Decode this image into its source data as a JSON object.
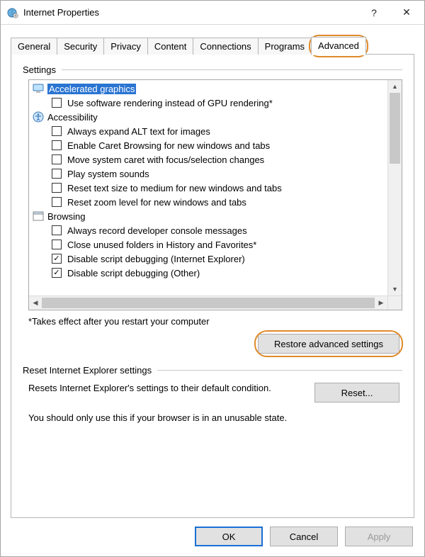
{
  "window": {
    "title": "Internet Properties",
    "help_label": "?",
    "close_label": "✕"
  },
  "tabs": [
    "General",
    "Security",
    "Privacy",
    "Content",
    "Connections",
    "Programs",
    "Advanced"
  ],
  "active_tab_index": 6,
  "settings_group_label": "Settings",
  "tree": {
    "categories": [
      {
        "icon": "monitor-icon",
        "label": "Accelerated graphics",
        "selected": true,
        "options": [
          {
            "label": "Use software rendering instead of GPU rendering*",
            "checked": false
          }
        ]
      },
      {
        "icon": "accessibility-icon",
        "label": "Accessibility",
        "selected": false,
        "options": [
          {
            "label": "Always expand ALT text for images",
            "checked": false
          },
          {
            "label": "Enable Caret Browsing for new windows and tabs",
            "checked": false
          },
          {
            "label": "Move system caret with focus/selection changes",
            "checked": false
          },
          {
            "label": "Play system sounds",
            "checked": false
          },
          {
            "label": "Reset text size to medium for new windows and tabs",
            "checked": false
          },
          {
            "label": "Reset zoom level for new windows and tabs",
            "checked": false
          }
        ]
      },
      {
        "icon": "window-icon",
        "label": "Browsing",
        "selected": false,
        "options": [
          {
            "label": "Always record developer console messages",
            "checked": false
          },
          {
            "label": "Close unused folders in History and Favorites*",
            "checked": false
          },
          {
            "label": "Disable script debugging (Internet Explorer)",
            "checked": true
          },
          {
            "label": "Disable script debugging (Other)",
            "checked": true
          }
        ]
      }
    ]
  },
  "restart_note": "*Takes effect after you restart your computer",
  "restore_button": "Restore advanced settings",
  "reset_group_label": "Reset Internet Explorer settings",
  "reset_text": "Resets Internet Explorer's settings to their default condition.",
  "reset_button": "Reset...",
  "reset_warning": "You should only use this if your browser is in an unusable state.",
  "footer": {
    "ok": "OK",
    "cancel": "Cancel",
    "apply": "Apply"
  }
}
